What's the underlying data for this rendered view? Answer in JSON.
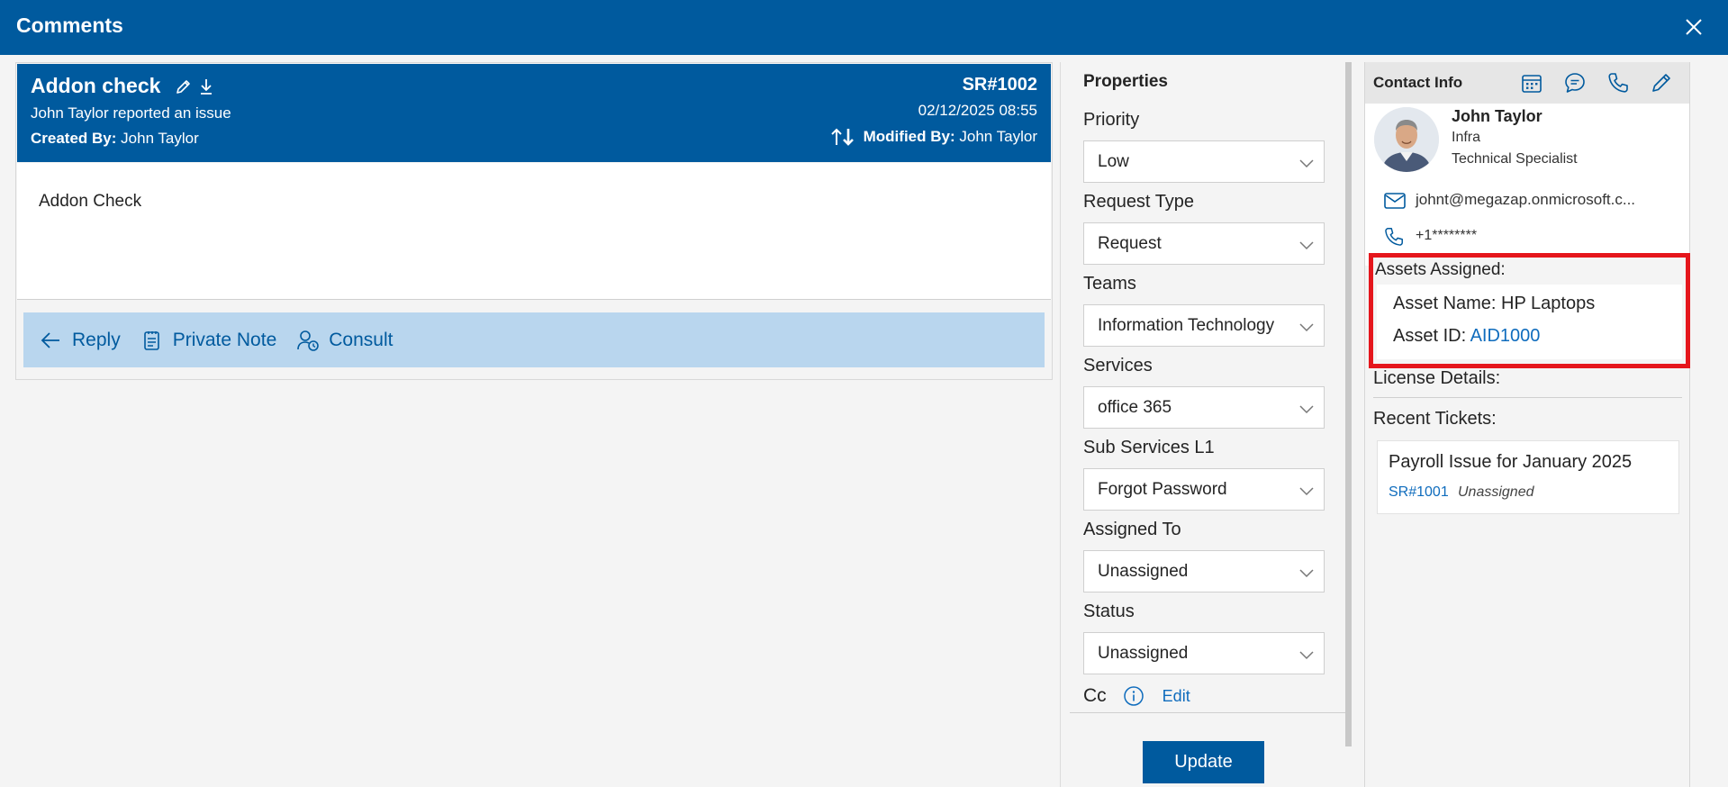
{
  "window": {
    "title": "Comments"
  },
  "ticket": {
    "title": "Addon check",
    "subtitle": "John Taylor reported an issue",
    "created_by_label": "Created By:",
    "created_by": "John Taylor",
    "id": "SR#1002",
    "date": "02/12/2025 08:55",
    "modified_by_label": "Modified By:",
    "modified_by": "John Taylor",
    "body": "Addon Check",
    "actions": {
      "reply": "Reply",
      "private_note": "Private Note",
      "consult": "Consult"
    }
  },
  "properties": {
    "title": "Properties",
    "fields": {
      "priority": {
        "label": "Priority",
        "value": "Low"
      },
      "request_type": {
        "label": "Request Type",
        "value": "Request"
      },
      "teams": {
        "label": "Teams",
        "value": "Information Technology"
      },
      "services": {
        "label": "Services",
        "value": "office 365"
      },
      "sub_services": {
        "label": "Sub Services L1",
        "value": "Forgot Password"
      },
      "assigned_to": {
        "label": "Assigned To",
        "value": "Unassigned"
      },
      "status": {
        "label": "Status",
        "value": "Unassigned"
      }
    },
    "cc_label": "Cc",
    "cc_edit": "Edit",
    "update_label": "Update"
  },
  "contact": {
    "title": "Contact Info",
    "name": "John Taylor",
    "department": "Infra",
    "role": "Technical Specialist",
    "email": "johnt@megazap.onmicrosoft.c...",
    "phone": "+1********",
    "assets_title": "Assets Assigned:",
    "asset_name_label": "Asset Name:",
    "asset_name": "HP Laptops",
    "asset_id_label": "Asset ID:",
    "asset_id": "AID1000",
    "license_title": "License Details:",
    "recent_title": "Recent Tickets:",
    "recent": [
      {
        "title": "Payroll Issue for January 2025",
        "id": "SR#1001",
        "status": "Unassigned"
      }
    ]
  },
  "colors": {
    "brand": "#005a9e",
    "action_bar": "#b9d6ee",
    "link": "#0f6cbd",
    "highlight": "#e5161c"
  }
}
